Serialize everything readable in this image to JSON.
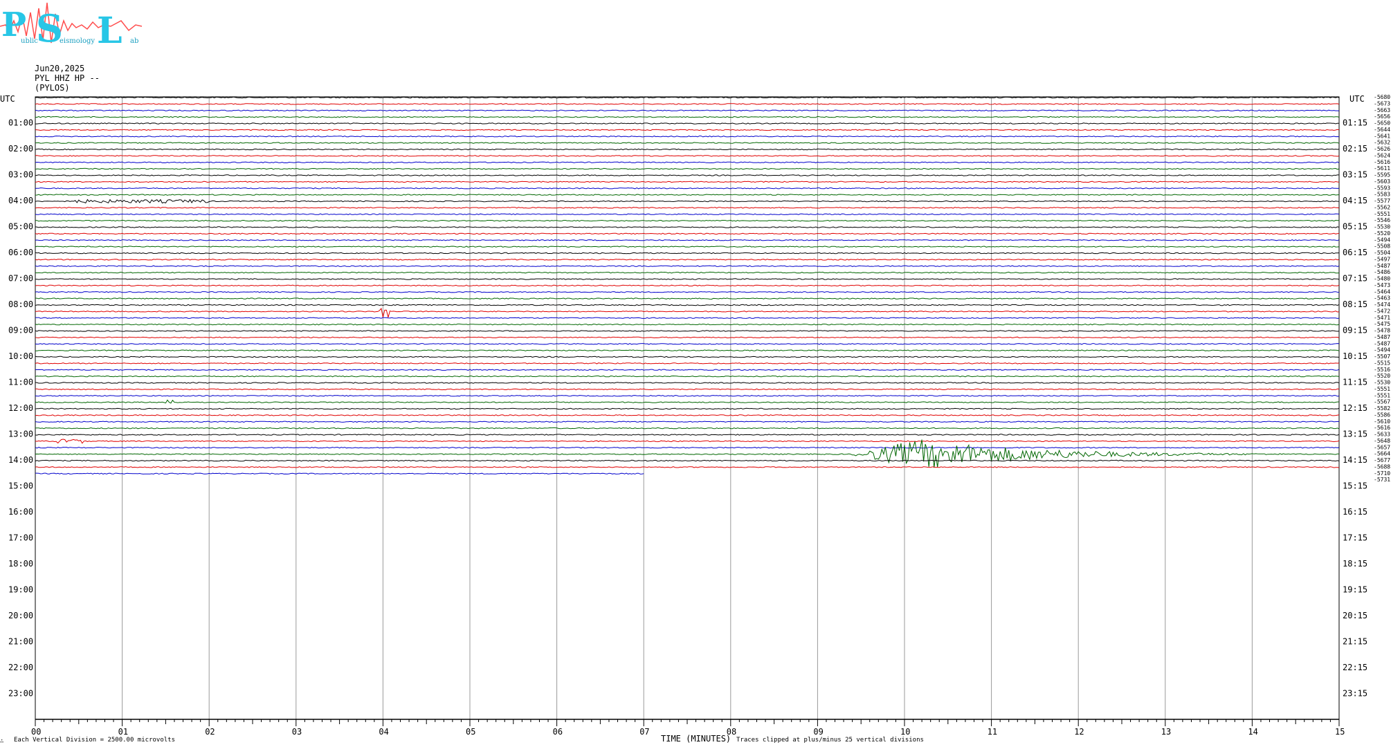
{
  "logo": {
    "text_top": "PSL",
    "text_sub_1": "ublic",
    "text_sub_2": "eismology",
    "text_sub_3": "ab"
  },
  "header": {
    "date": "Jun20,2025",
    "station": "PYL HHZ HP --",
    "site": "(PYLOS)"
  },
  "axis": {
    "left_label": "UTC",
    "right_label": "UTC",
    "xlabel": "TIME (MINUTES)",
    "scale_note": "Each Vertical Division = 2500.00 microvolts",
    "clip_note": "Traces clipped at plus/minus 25 vertical divisions",
    "corner_mark": "∴"
  },
  "chart_data": {
    "type": "line",
    "title": "",
    "xlim": [
      0,
      15
    ],
    "x_ticks": [
      "00",
      "01",
      "02",
      "03",
      "04",
      "05",
      "06",
      "07",
      "08",
      "09",
      "10",
      "11",
      "12",
      "13",
      "14",
      "15"
    ],
    "rows_total": 96,
    "rows_recorded": 59,
    "last_row_end_minute": 7,
    "row_minutes": 15,
    "colors": [
      "#000000",
      "#e00000",
      "#0000cc",
      "#006600"
    ],
    "left_hour_labels": [
      "01:00",
      "02:00",
      "03:00",
      "04:00",
      "05:00",
      "06:00",
      "07:00",
      "08:00",
      "09:00",
      "10:00",
      "11:00",
      "12:00",
      "13:00",
      "14:00",
      "15:00",
      "16:00",
      "17:00",
      "18:00",
      "19:00",
      "20:00",
      "21:00",
      "22:00",
      "23:00"
    ],
    "right_hour_labels": [
      "01:15",
      "02:15",
      "03:15",
      "04:15",
      "05:15",
      "06:15",
      "07:15",
      "08:15",
      "09:15",
      "10:15",
      "11:15",
      "12:15",
      "13:15",
      "14:15",
      "15:15",
      "16:15",
      "17:15",
      "18:15",
      "19:15",
      "20:15",
      "21:15",
      "22:15",
      "23:15"
    ],
    "offsets": [
      "-5680",
      "-5673",
      "-5663",
      "-5656",
      "-5650",
      "-5644",
      "-5641",
      "-5632",
      "-5626",
      "-5624",
      "-5616",
      "-5611",
      "-5595",
      "-5603",
      "-5593",
      "-5583",
      "-5577",
      "-5562",
      "-5551",
      "-5546",
      "-5530",
      "-5520",
      "-5494",
      "-5508",
      "-5504",
      "-5497",
      "-5487",
      "-5486",
      "-5480",
      "-5473",
      "-5464",
      "-5463",
      "-5474",
      "-5472",
      "-5471",
      "-5475",
      "-5478",
      "-5487",
      "-5487",
      "-5494",
      "-5507",
      "-5515",
      "-5516",
      "-5520",
      "-5530",
      "-5551",
      "-5551",
      "-5567",
      "-5582",
      "-5586",
      "-5610",
      "-5616",
      "-5633",
      "-5648",
      "-5657",
      "-5664",
      "-5677",
      "-5688",
      "-5710",
      "-5731"
    ],
    "events": [
      {
        "row": 16,
        "start_min": 0.45,
        "end_min": 2.0,
        "amp": 2.5,
        "kind": "noise"
      },
      {
        "row": 33,
        "start_min": 3.95,
        "end_min": 4.1,
        "amp": 14,
        "kind": "spike"
      },
      {
        "row": 31,
        "start_min": 7.75,
        "end_min": 7.85,
        "amp": 4,
        "kind": "spike"
      },
      {
        "row": 47,
        "start_min": 1.5,
        "end_min": 1.6,
        "amp": 6,
        "kind": "blip"
      },
      {
        "row": 53,
        "start_min": 0.25,
        "end_min": 0.6,
        "amp": 3,
        "kind": "noise"
      },
      {
        "row": 55,
        "start_min": 9.35,
        "end_min": 15.0,
        "amp": 22,
        "kind": "quake"
      }
    ]
  }
}
